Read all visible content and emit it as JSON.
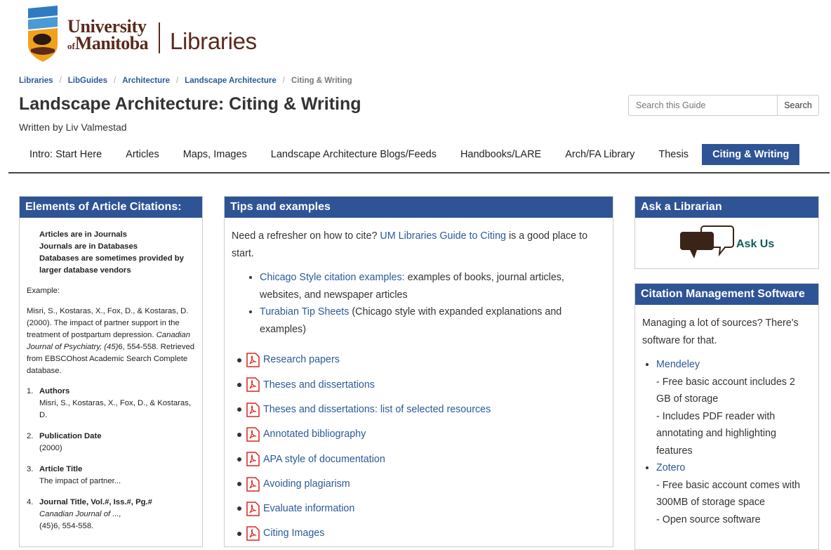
{
  "header": {
    "logo": {
      "line1": "University",
      "of": "of",
      "line2": "Manitoba",
      "libraries": "Libraries"
    }
  },
  "breadcrumb": [
    "Libraries",
    "LibGuides",
    "Architecture",
    "Landscape Architecture",
    "Citing & Writing"
  ],
  "page": {
    "title": "Landscape Architecture: Citing & Writing",
    "author": "Written by Liv Valmestad"
  },
  "search": {
    "placeholder": "Search this Guide",
    "button": "Search"
  },
  "tabs": [
    "Intro: Start Here",
    "Articles",
    "Maps, Images",
    "Landscape Architecture Blogs/Feeds",
    "Handbooks/LARE",
    "Arch/FA Library",
    "Thesis",
    "Citing & Writing"
  ],
  "left_box": {
    "heading": "Elements of Article Citations:",
    "intro": [
      "Articles are in Journals",
      "Journals are in Databases",
      "Databases are sometimes provided by larger database vendors"
    ],
    "example_label": "Example:",
    "citation_plain": "Misri, S., Kostaras, X., Fox, D., & Kostaras, D. (2000). The impact of partner support in the treatment of postpartum depression.",
    "citation_italic": "Canadian Journal of Psychiatry, (45)",
    "citation_after": "6, 554-558. Retrieved from EBSCOhost Academic Search Complete database.",
    "elements": [
      {
        "num": "1.",
        "label": "Authors",
        "value": "Misri, S., Kostaras, X., Fox, D., & Kostaras, D.",
        "italic": ""
      },
      {
        "num": "2.",
        "label": "Publication Date",
        "value": "(2000)",
        "italic": ""
      },
      {
        "num": "3.",
        "label": "Article Title",
        "value": "The impact of partner...",
        "italic": ""
      },
      {
        "num": "4.",
        "label": "Journal Title, Vol.#, Iss.#, Pg.#",
        "italic": "Canadian Journal of ...,",
        "value": "(45)6, 554-558."
      }
    ]
  },
  "mid_box": {
    "heading": "Tips and examples",
    "intro_before": "Need a refresher on how to cite? ",
    "intro_link": "UM Libraries Guide to Citing",
    "intro_after": " is a good place to start.",
    "links": [
      {
        "link": "Chicago Style citation examples:",
        "text": " examples of books, journal articles, websites, and newspaper articles"
      },
      {
        "link": "Turabian Tip Sheets",
        "text": " (Chicago style with expanded explanations and examples)"
      }
    ],
    "pdfs": [
      "Research papers",
      "Theses and dissertations",
      "Theses and dissertations: list of selected resources",
      "Annotated bibliography",
      "APA style of documentation",
      "Avoiding plagiarism",
      "Evaluate information",
      "Citing Images"
    ]
  },
  "ask_box": {
    "heading": "Ask a Librarian",
    "link": "Ask Us"
  },
  "cms_box": {
    "heading": "Citation Management Software",
    "intro": "Managing a lot of sources? There's software for that.",
    "items": [
      {
        "name": "Mendeley",
        "notes": [
          "- Free basic account includes 2 GB of storage",
          "- Includes PDF reader with annotating and highlighting features"
        ]
      },
      {
        "name": "Zotero",
        "notes": [
          "- Free basic account comes with 300MB of storage space",
          "- Open source software"
        ]
      }
    ]
  },
  "colors": {
    "accent": "#2f5496",
    "brand": "#5b2a1d",
    "link": "#2a5a9a",
    "pdf": "#d9261c"
  }
}
